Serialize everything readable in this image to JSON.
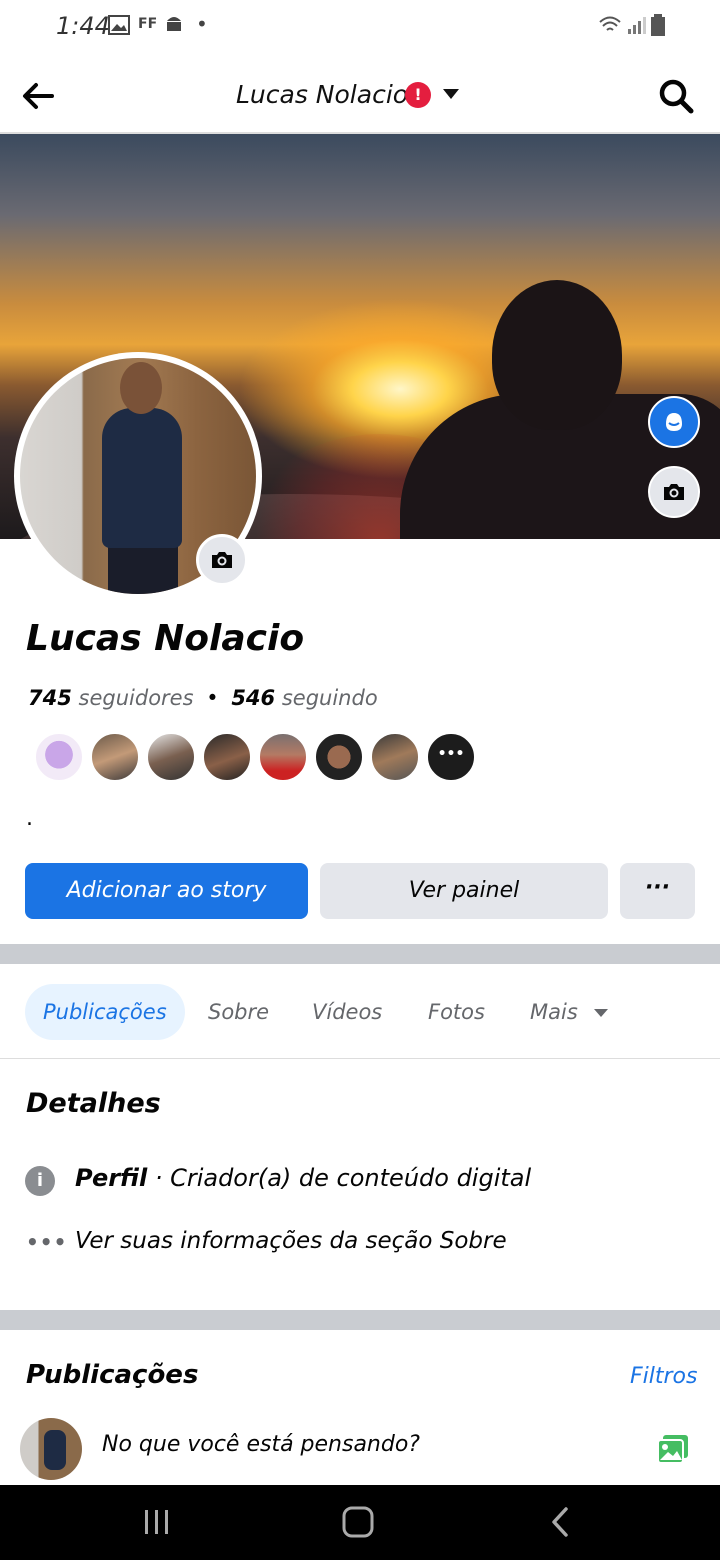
{
  "status_bar": {
    "time": "1:44",
    "icons": [
      "gallery-icon",
      "ff-icon",
      "android-icon",
      "dot-icon",
      "wifi-icon",
      "signal-icon",
      "battery-icon"
    ]
  },
  "header": {
    "title": "Lucas Nolacio",
    "badge": "!"
  },
  "profile": {
    "name": "Lucas Nolacio",
    "followers_count": "745",
    "followers_label": "seguidores",
    "separator": "•",
    "following_count": "546",
    "following_label": "seguindo",
    "followers_more": "•••",
    "bio": "."
  },
  "actions": {
    "add_story": "Adicionar ao story",
    "view_panel": "Ver painel",
    "more": "···"
  },
  "tabs": [
    {
      "label": "Publicações"
    },
    {
      "label": "Sobre"
    },
    {
      "label": "Vídeos"
    },
    {
      "label": "Fotos"
    },
    {
      "label": "Mais"
    }
  ],
  "details": {
    "title": "Detalhes",
    "profile_label": "Perfil",
    "profile_value": " · Criador(a) de conteúdo digital",
    "about_link": "Ver suas informações da seção Sobre"
  },
  "posts": {
    "title": "Publicações",
    "filters": "Filtros",
    "composer_placeholder": "No que você está pensando?"
  },
  "colors": {
    "accent": "#1b74e4",
    "badge": "#e41e3f",
    "photo_icon": "#45bd62"
  }
}
